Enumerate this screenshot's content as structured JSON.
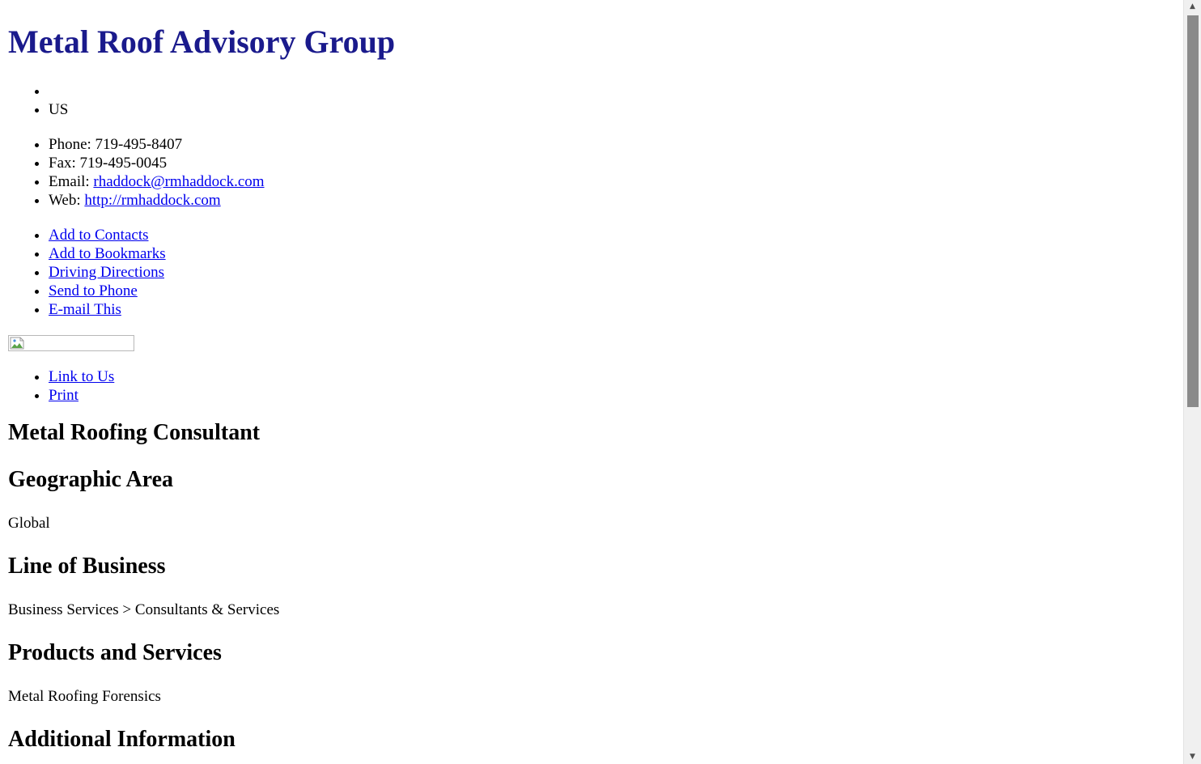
{
  "header": {
    "title": "Metal Roof Advisory Group"
  },
  "address": {
    "items": [
      "",
      "US"
    ]
  },
  "contact": {
    "phone_label": "Phone: ",
    "phone": "719-495-8407",
    "fax_label": "Fax: ",
    "fax": "719-495-0045",
    "email_label": "Email: ",
    "email": "rhaddock@rmhaddock.com",
    "web_label": "Web: ",
    "web": "http://rmhaddock.com"
  },
  "actions": {
    "add_contacts": "Add to Contacts",
    "add_bookmarks": "Add to Bookmarks",
    "driving_directions": "Driving Directions",
    "send_to_phone": "Send to Phone",
    "email_this": "E-mail This"
  },
  "image": {
    "icon": "broken-image-icon"
  },
  "links": {
    "link_to_us": "Link to Us",
    "print": "Print"
  },
  "sections": {
    "category": "Metal Roofing Consultant",
    "geo_heading": "Geographic Area",
    "geo_text": "Global",
    "lob_heading": "Line of Business",
    "lob_text": "Business Services > Consultants & Services",
    "products_heading": "Products and Services",
    "products_text": "Metal Roofing Forensics",
    "additional_heading": "Additional Information"
  },
  "scrollbar": {
    "up_icon": "chevron-up-icon",
    "down_icon": "chevron-down-icon",
    "up_glyph": "▲",
    "down_glyph": "▼"
  },
  "colors": {
    "title": "#1a1a8c",
    "link": "#0000ee",
    "text": "#000000",
    "background": "#ffffff"
  }
}
